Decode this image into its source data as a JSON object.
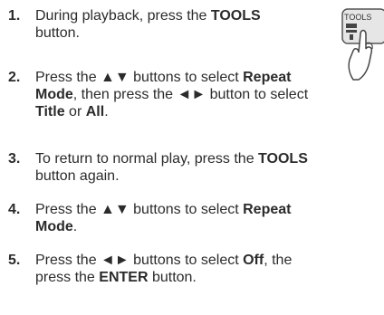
{
  "steps": [
    {
      "number": "1.",
      "lines": [
        [
          {
            "t": "During playback, press the "
          },
          {
            "t": "TOOLS",
            "b": true
          }
        ],
        [
          {
            "t": "button."
          }
        ]
      ]
    },
    {
      "number": "2.",
      "lines": [
        [
          {
            "t": "Press the ▲▼ buttons to select "
          },
          {
            "t": "Repeat",
            "b": true
          }
        ],
        [
          {
            "t": "Mode",
            "b": true
          },
          {
            "t": ", then press the ◄► button to select"
          }
        ],
        [
          {
            "t": "Title",
            "b": true
          },
          {
            "t": " or "
          },
          {
            "t": "All",
            "b": true
          },
          {
            "t": "."
          }
        ]
      ]
    },
    {
      "number": "3.",
      "lines": [
        [
          {
            "t": "To return to normal play, press the "
          },
          {
            "t": "TOOLS",
            "b": true
          }
        ],
        [
          {
            "t": "button again."
          }
        ]
      ]
    },
    {
      "number": "4.",
      "lines": [
        [
          {
            "t": "Press the ▲▼ buttons to select "
          },
          {
            "t": "Repeat",
            "b": true
          }
        ],
        [
          {
            "t": "Mode",
            "b": true
          },
          {
            "t": "."
          }
        ]
      ]
    },
    {
      "number": "5.",
      "lines": [
        [
          {
            "t": "Press the ◄► buttons to select "
          },
          {
            "t": "Off",
            "b": true
          },
          {
            "t": ", the"
          }
        ],
        [
          {
            "t": "press the "
          },
          {
            "t": "ENTER",
            "b": true
          },
          {
            "t": " button."
          }
        ]
      ]
    }
  ],
  "remote_icon": {
    "icon": "remote-tools-button-icon",
    "label": "TOOLS"
  }
}
